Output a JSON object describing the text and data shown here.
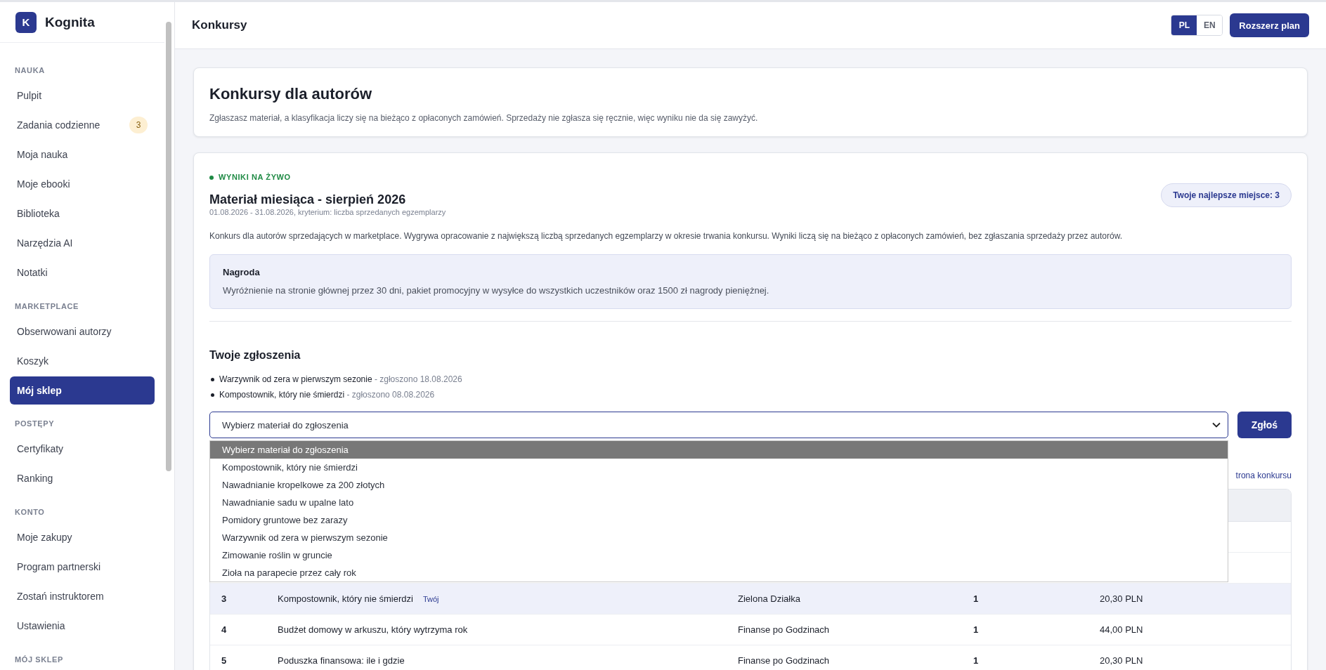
{
  "brand": {
    "logo_letter": "K",
    "name": "Kognita"
  },
  "sidebar": {
    "sections": [
      {
        "title": "NAUKA",
        "items": [
          {
            "label": "Pulpit",
            "selected": false
          },
          {
            "label": "Zadania codzienne",
            "selected": false,
            "badge": "3"
          },
          {
            "label": "Moja nauka",
            "selected": false
          },
          {
            "label": "Moje ebooki",
            "selected": false
          },
          {
            "label": "Biblioteka",
            "selected": false
          },
          {
            "label": "Narzędzia AI",
            "selected": false
          },
          {
            "label": "Notatki",
            "selected": false
          }
        ]
      },
      {
        "title": "MARKETPLACE",
        "items": [
          {
            "label": "Obserwowani autorzy",
            "selected": false
          },
          {
            "label": "Koszyk",
            "selected": false
          },
          {
            "label": "Mój sklep",
            "selected": true
          }
        ]
      },
      {
        "title": "POSTĘPY",
        "items": [
          {
            "label": "Certyfikaty",
            "selected": false
          },
          {
            "label": "Ranking",
            "selected": false
          }
        ]
      },
      {
        "title": "KONTO",
        "items": [
          {
            "label": "Moje zakupy",
            "selected": false
          },
          {
            "label": "Program partnerski",
            "selected": false
          },
          {
            "label": "Zostań instruktorem",
            "selected": false
          },
          {
            "label": "Ustawienia",
            "selected": false
          }
        ]
      },
      {
        "title": "MÓJ SKLEP"
      }
    ]
  },
  "header": {
    "title": "Konkursy",
    "languages": [
      {
        "label": "PL",
        "selected": true
      },
      {
        "label": "EN",
        "selected": false
      }
    ],
    "upgrade_button": "Rozszerz plan"
  },
  "intro": {
    "title": "Konkursy dla autorów",
    "text": "Zgłaszasz materiał, a klasyfikacja liczy się na bieżąco z opłaconych zamówień. Sprzedaży nie zgłasza się ręcznie, więc wyniku nie da się zawyżyć."
  },
  "contest": {
    "live_label": "WYNIKI NA ŻYWO",
    "title": "Materiał miesiąca - sierpień 2026",
    "meta": "01.08.2026 - 31.08.2026, kryterium: liczba sprzedanych egzemplarzy",
    "best_place": "Twoje najlepsze miejsce: 3",
    "description": "Konkurs dla autorów sprzedających w marketplace. Wygrywa opracowanie z największą liczbą sprzedanych egzemplarzy w okresie trwania konkursu. Wyniki liczą się na bieżąco z opłaconych zamówień, bez zgłaszania sprzedaży przez autorów.",
    "prize": {
      "title": "Nagroda",
      "text": "Wyróżnienie na stronie głównej przez 30 dni, pakiet promocyjny w wysyłce do wszystkich uczestników oraz 1500 zł nagrody pieniężnej."
    },
    "entries_title": "Twoje zgłoszenia",
    "entries": [
      {
        "title": "Warzywnik od zera w pierwszym sezonie",
        "date": "- zgłoszono 18.08.2026"
      },
      {
        "title": "Kompostownik, który nie śmierdzi",
        "date": "- zgłoszono 08.08.2026"
      }
    ],
    "select": {
      "value": "Wybierz materiał do zgłoszenia",
      "expanded": true,
      "options": [
        {
          "label": "Wybierz materiał do zgłoszenia",
          "selected": true
        },
        {
          "label": "Kompostownik, który nie śmierdzi",
          "selected": false
        },
        {
          "label": "Nawadnianie kropelkowe za 200 złotych",
          "selected": false
        },
        {
          "label": "Nawadnianie sadu w upalne lato",
          "selected": false
        },
        {
          "label": "Pomidory gruntowe bez zarazy",
          "selected": false
        },
        {
          "label": "Warzywnik od zera w pierwszym sezonie",
          "selected": false
        },
        {
          "label": "Zimowanie roślin w gruncie",
          "selected": false
        },
        {
          "label": "Zioła na parapecie przez cały rok",
          "selected": false
        }
      ]
    },
    "submit_button": "Zgłoś",
    "page_link": "trona konkursu",
    "ranking": {
      "rows": [
        {
          "rank": "3",
          "title": "Kompostownik, który nie śmierdzi",
          "tag": "Twój",
          "own": true,
          "shop": "Zielona Działka",
          "count": "1",
          "amount": "20,30 PLN"
        },
        {
          "rank": "4",
          "title": "Budżet domowy w arkuszu, który wytrzyma rok",
          "own": false,
          "shop": "Finanse po Godzinach",
          "count": "1",
          "amount": "44,00 PLN"
        },
        {
          "rank": "5",
          "title": "Poduszka finansowa: ile i gdzie",
          "own": false,
          "shop": "Finanse po Godzinach",
          "count": "1",
          "amount": "20,30 PLN"
        }
      ]
    }
  }
}
